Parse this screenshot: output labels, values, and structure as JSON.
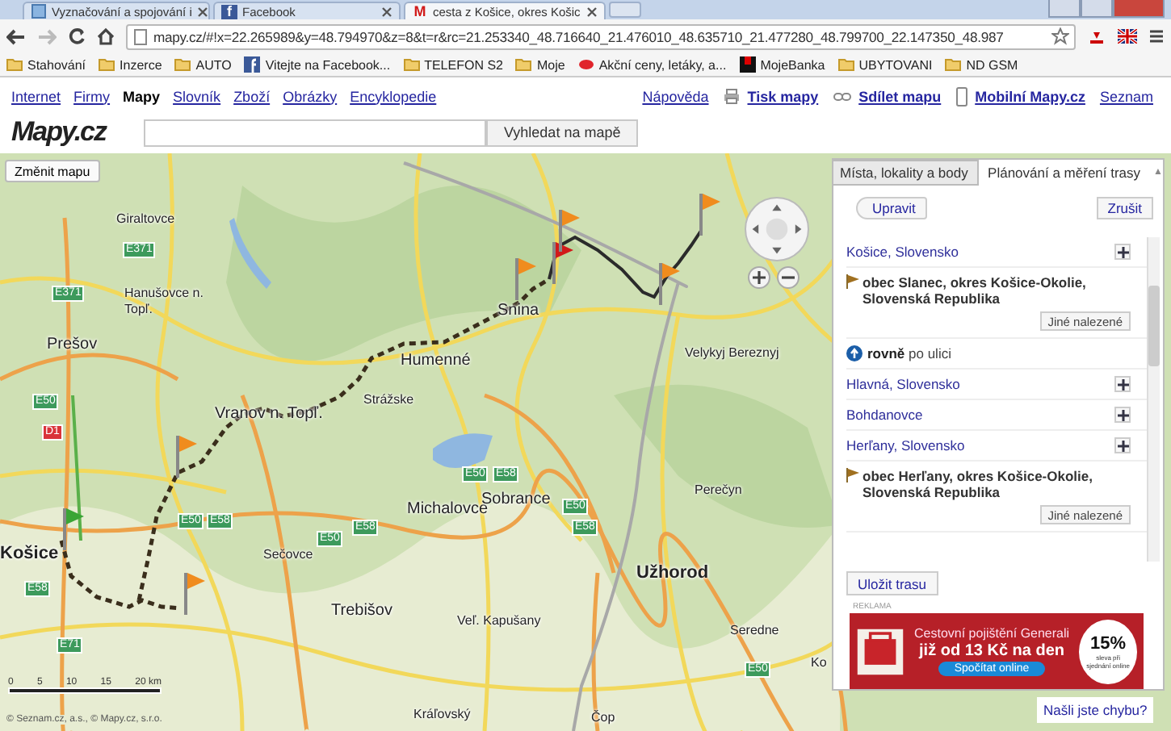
{
  "browser": {
    "tabs": [
      {
        "title": "Vyznačování a spojování i",
        "selected": false
      },
      {
        "title": "Facebook",
        "favicon": "f",
        "selected": false
      },
      {
        "title": "cesta z Košice, okres Košic",
        "favicon": "M",
        "selected": true
      }
    ],
    "url": "mapy.cz/#!x=22.265989&y=48.794970&z=8&t=r&rc=21.253340_48.716640_21.476010_48.635710_21.477280_48.799700_22.147350_48.987",
    "bookmarks": [
      {
        "label": "Stahování",
        "kind": "folder"
      },
      {
        "label": "Inzerce",
        "kind": "folder"
      },
      {
        "label": "AUTO",
        "kind": "folder"
      },
      {
        "label": "Vitejte na Facebook...",
        "kind": "facebook"
      },
      {
        "label": "TELEFON S2",
        "kind": "folder"
      },
      {
        "label": "Moje",
        "kind": "folder"
      },
      {
        "label": "Akční ceny, letáky, a...",
        "kind": "offer"
      },
      {
        "label": "MojeBanka",
        "kind": "bank"
      },
      {
        "label": "UBYTOVANI",
        "kind": "folder"
      },
      {
        "label": "ND GSM",
        "kind": "folder"
      }
    ]
  },
  "site_nav": [
    {
      "label": "Internet",
      "selected": false
    },
    {
      "label": "Firmy",
      "selected": false
    },
    {
      "label": "Mapy",
      "selected": true
    },
    {
      "label": "Slovník",
      "selected": false
    },
    {
      "label": "Zboží",
      "selected": false
    },
    {
      "label": "Obrázky",
      "selected": false
    },
    {
      "label": "Encyklopedie",
      "selected": false
    }
  ],
  "tools": [
    {
      "label": "Nápověda",
      "kind": "plain"
    },
    {
      "label": "Tisk mapy",
      "kind": "print"
    },
    {
      "label": "Sdílet mapu",
      "kind": "share"
    },
    {
      "label": "Mobilní Mapy.cz",
      "kind": "mobile"
    },
    {
      "label": "Seznam",
      "kind": "plain"
    }
  ],
  "logo": "Mapy.cz",
  "search": {
    "button": "Vyhledat na mapě"
  },
  "map": {
    "change_map": "Změnit mapu",
    "places": [
      {
        "label": "Giraltovce",
        "kind": "town"
      },
      {
        "label": "Hanušovce n. Topľ.",
        "kind": "town"
      },
      {
        "label": "Prešov",
        "kind": "city"
      },
      {
        "label": "Vranov n. Topľ.",
        "kind": "city"
      },
      {
        "label": "Humenné",
        "kind": "city"
      },
      {
        "label": "Strážske",
        "kind": "town"
      },
      {
        "label": "Snina",
        "kind": "city"
      },
      {
        "label": "Velykyj Bereznyj",
        "kind": "town"
      },
      {
        "label": "Košice",
        "kind": "capital"
      },
      {
        "label": "Sečovce",
        "kind": "town"
      },
      {
        "label": "Michalovce",
        "kind": "city"
      },
      {
        "label": "Sobrance",
        "kind": "city"
      },
      {
        "label": "Perečyn",
        "kind": "town"
      },
      {
        "label": "Užhorod",
        "kind": "capital"
      },
      {
        "label": "Trebišov",
        "kind": "city"
      },
      {
        "label": "Veľ. Kapušany",
        "kind": "town"
      },
      {
        "label": "Seredne",
        "kind": "town"
      },
      {
        "label": "Kráľovský",
        "kind": "town"
      },
      {
        "label": "Čop",
        "kind": "town"
      },
      {
        "label": "Ko",
        "kind": "town"
      }
    ],
    "shields": [
      {
        "label": "E371",
        "kind": "european"
      },
      {
        "label": "E371",
        "kind": "european"
      },
      {
        "label": "E50",
        "kind": "european"
      },
      {
        "label": "D1",
        "kind": "motorway"
      },
      {
        "label": "E50",
        "kind": "european"
      },
      {
        "label": "E58",
        "kind": "european"
      },
      {
        "label": "E50",
        "kind": "european"
      },
      {
        "label": "E58",
        "kind": "european"
      },
      {
        "label": "E58",
        "kind": "european"
      },
      {
        "label": "E71",
        "kind": "european"
      },
      {
        "label": "E50",
        "kind": "european"
      },
      {
        "label": "E58",
        "kind": "european"
      },
      {
        "label": "E50",
        "kind": "european"
      },
      {
        "label": "E58",
        "kind": "european"
      },
      {
        "label": "E50",
        "kind": "european"
      }
    ],
    "markers": [
      {
        "color": "#3aa535"
      },
      {
        "color": "#f08c1e"
      },
      {
        "color": "#f08c1e"
      },
      {
        "color": "#f08c1e"
      },
      {
        "color": "#d11a1a"
      },
      {
        "color": "#f08c1e"
      },
      {
        "color": "#f08c1e"
      },
      {
        "color": "#f08c1e"
      }
    ],
    "scale": [
      "0",
      "5",
      "10",
      "15",
      "20 km"
    ],
    "copyright": "© Seznam.cz, a.s., © Mapy.cz, s.r.o.",
    "report": "Našli jste chybu?"
  },
  "panel": {
    "tabs": [
      {
        "label": "Místa, lokality a body",
        "selected": false
      },
      {
        "label": "Plánování a měření trasy",
        "selected": true
      }
    ],
    "collapse": "▲",
    "edit": "Upravit",
    "cancel": "Zrušit",
    "steps": [
      {
        "kind": "waypoint",
        "text": "Košice, Slovensko"
      },
      {
        "kind": "place",
        "text": "obec Slanec, okres Košice-Okolie, Slovenská Republika",
        "button": "Jiné nalezené"
      },
      {
        "kind": "instruction",
        "text": "**rovně** po ulici"
      },
      {
        "kind": "waypoint",
        "text": "Hlavná, Slovensko"
      },
      {
        "kind": "waypoint",
        "text": "Bohdanovce"
      },
      {
        "kind": "waypoint",
        "text": "Herľany, Slovensko"
      },
      {
        "kind": "place",
        "text": "obec Herľany, okres Košice-Okolie, Slovenská Republika",
        "button": "Jiné nalezené"
      }
    ],
    "save": "Uložit trasu",
    "ad_label": "REKLAMA",
    "ad": {
      "title": "Cestovní pojištění Generali",
      "offer": "již od 13 Kč na den",
      "button": "Spočítat online",
      "discount": "15%",
      "discount_note": "sleva při sjednání online"
    }
  }
}
